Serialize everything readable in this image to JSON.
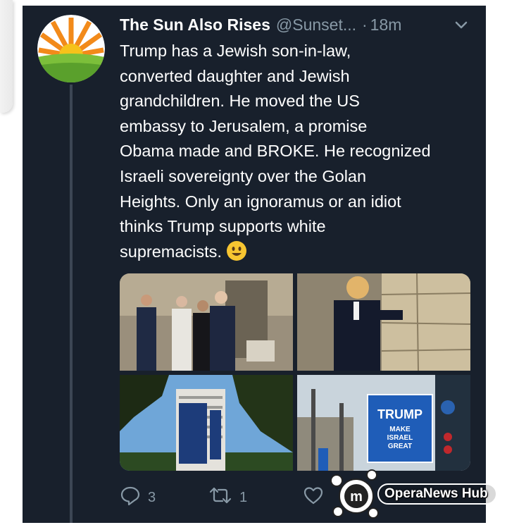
{
  "tweet": {
    "display_name": "The Sun Also Rises",
    "handle": "@Sunset...",
    "separator": "·",
    "time": "18m",
    "text_lines": [
      "Trump has a Jewish son-in-law,",
      "converted daughter and Jewish",
      "grandchildren. He moved the US",
      "embassy to Jerusalem, a promise",
      "Obama made and BROKE. He recognized",
      "Israeli sovereignty over the Golan",
      "Heights. Only an ignoramus or an idiot",
      "thinks Trump supports white",
      "supremacists."
    ],
    "media": {
      "photo4_sign": [
        "TRUMP",
        "MAKE",
        "ISRAEL",
        "GREAT"
      ]
    },
    "actions": {
      "reply_count": "3",
      "retweet_count": "1"
    }
  },
  "watermark": {
    "text": "OperaNews Hub"
  },
  "colors": {
    "background": "#18202c",
    "text": "#ffffff",
    "muted": "#8899a6"
  },
  "icons": [
    "chevron-down-icon",
    "smiley-emoji-icon",
    "reply-icon",
    "retweet-icon",
    "like-icon"
  ]
}
